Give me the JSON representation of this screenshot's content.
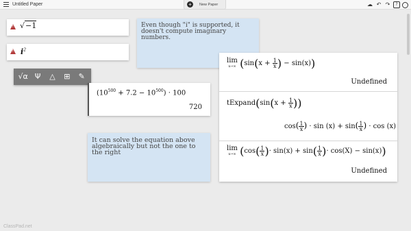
{
  "app": {
    "document_title": "Untitled Paper",
    "new_paper_label": "New Paper",
    "footer_logo": "ClassPad.net",
    "toolbar_icons": [
      "cloud-icon",
      "undo-icon",
      "redo-icon",
      "help-icon",
      "record-icon"
    ]
  },
  "cards": {
    "sqrt_card": {
      "expr_prefix": "√",
      "expr_radicand": "−1"
    },
    "i_squared_card": {
      "base": "i",
      "exponent": "2"
    },
    "note1": {
      "text": "Even though \"i\" is supported, it doesn't compute imaginary numbers."
    },
    "note2": {
      "text": "It can solve the equation above algebraically but not the one to the right"
    },
    "calc_card": {
      "expr_a": "(10",
      "exp_a": "500",
      "expr_b": " + 7.2 − 10",
      "exp_b": "500",
      "expr_c": ") · 100",
      "result": "720"
    },
    "limit_card": {
      "row1_result": "Undefined",
      "row2_func": "tExpand",
      "row3_result": "Undefined",
      "lim_word": "lim",
      "lim_sub": "x→∞"
    }
  },
  "math_toolbar": {
    "tools": [
      "sqrt-alpha-icon",
      "psi-icon",
      "shapes-icon",
      "table-icon",
      "edit-icon"
    ]
  },
  "colors": {
    "background": "#ebebeb",
    "note_blue": "#d4e4f3",
    "warning_red": "#b23a3a",
    "toolbar_gray": "#7a7a7a"
  }
}
